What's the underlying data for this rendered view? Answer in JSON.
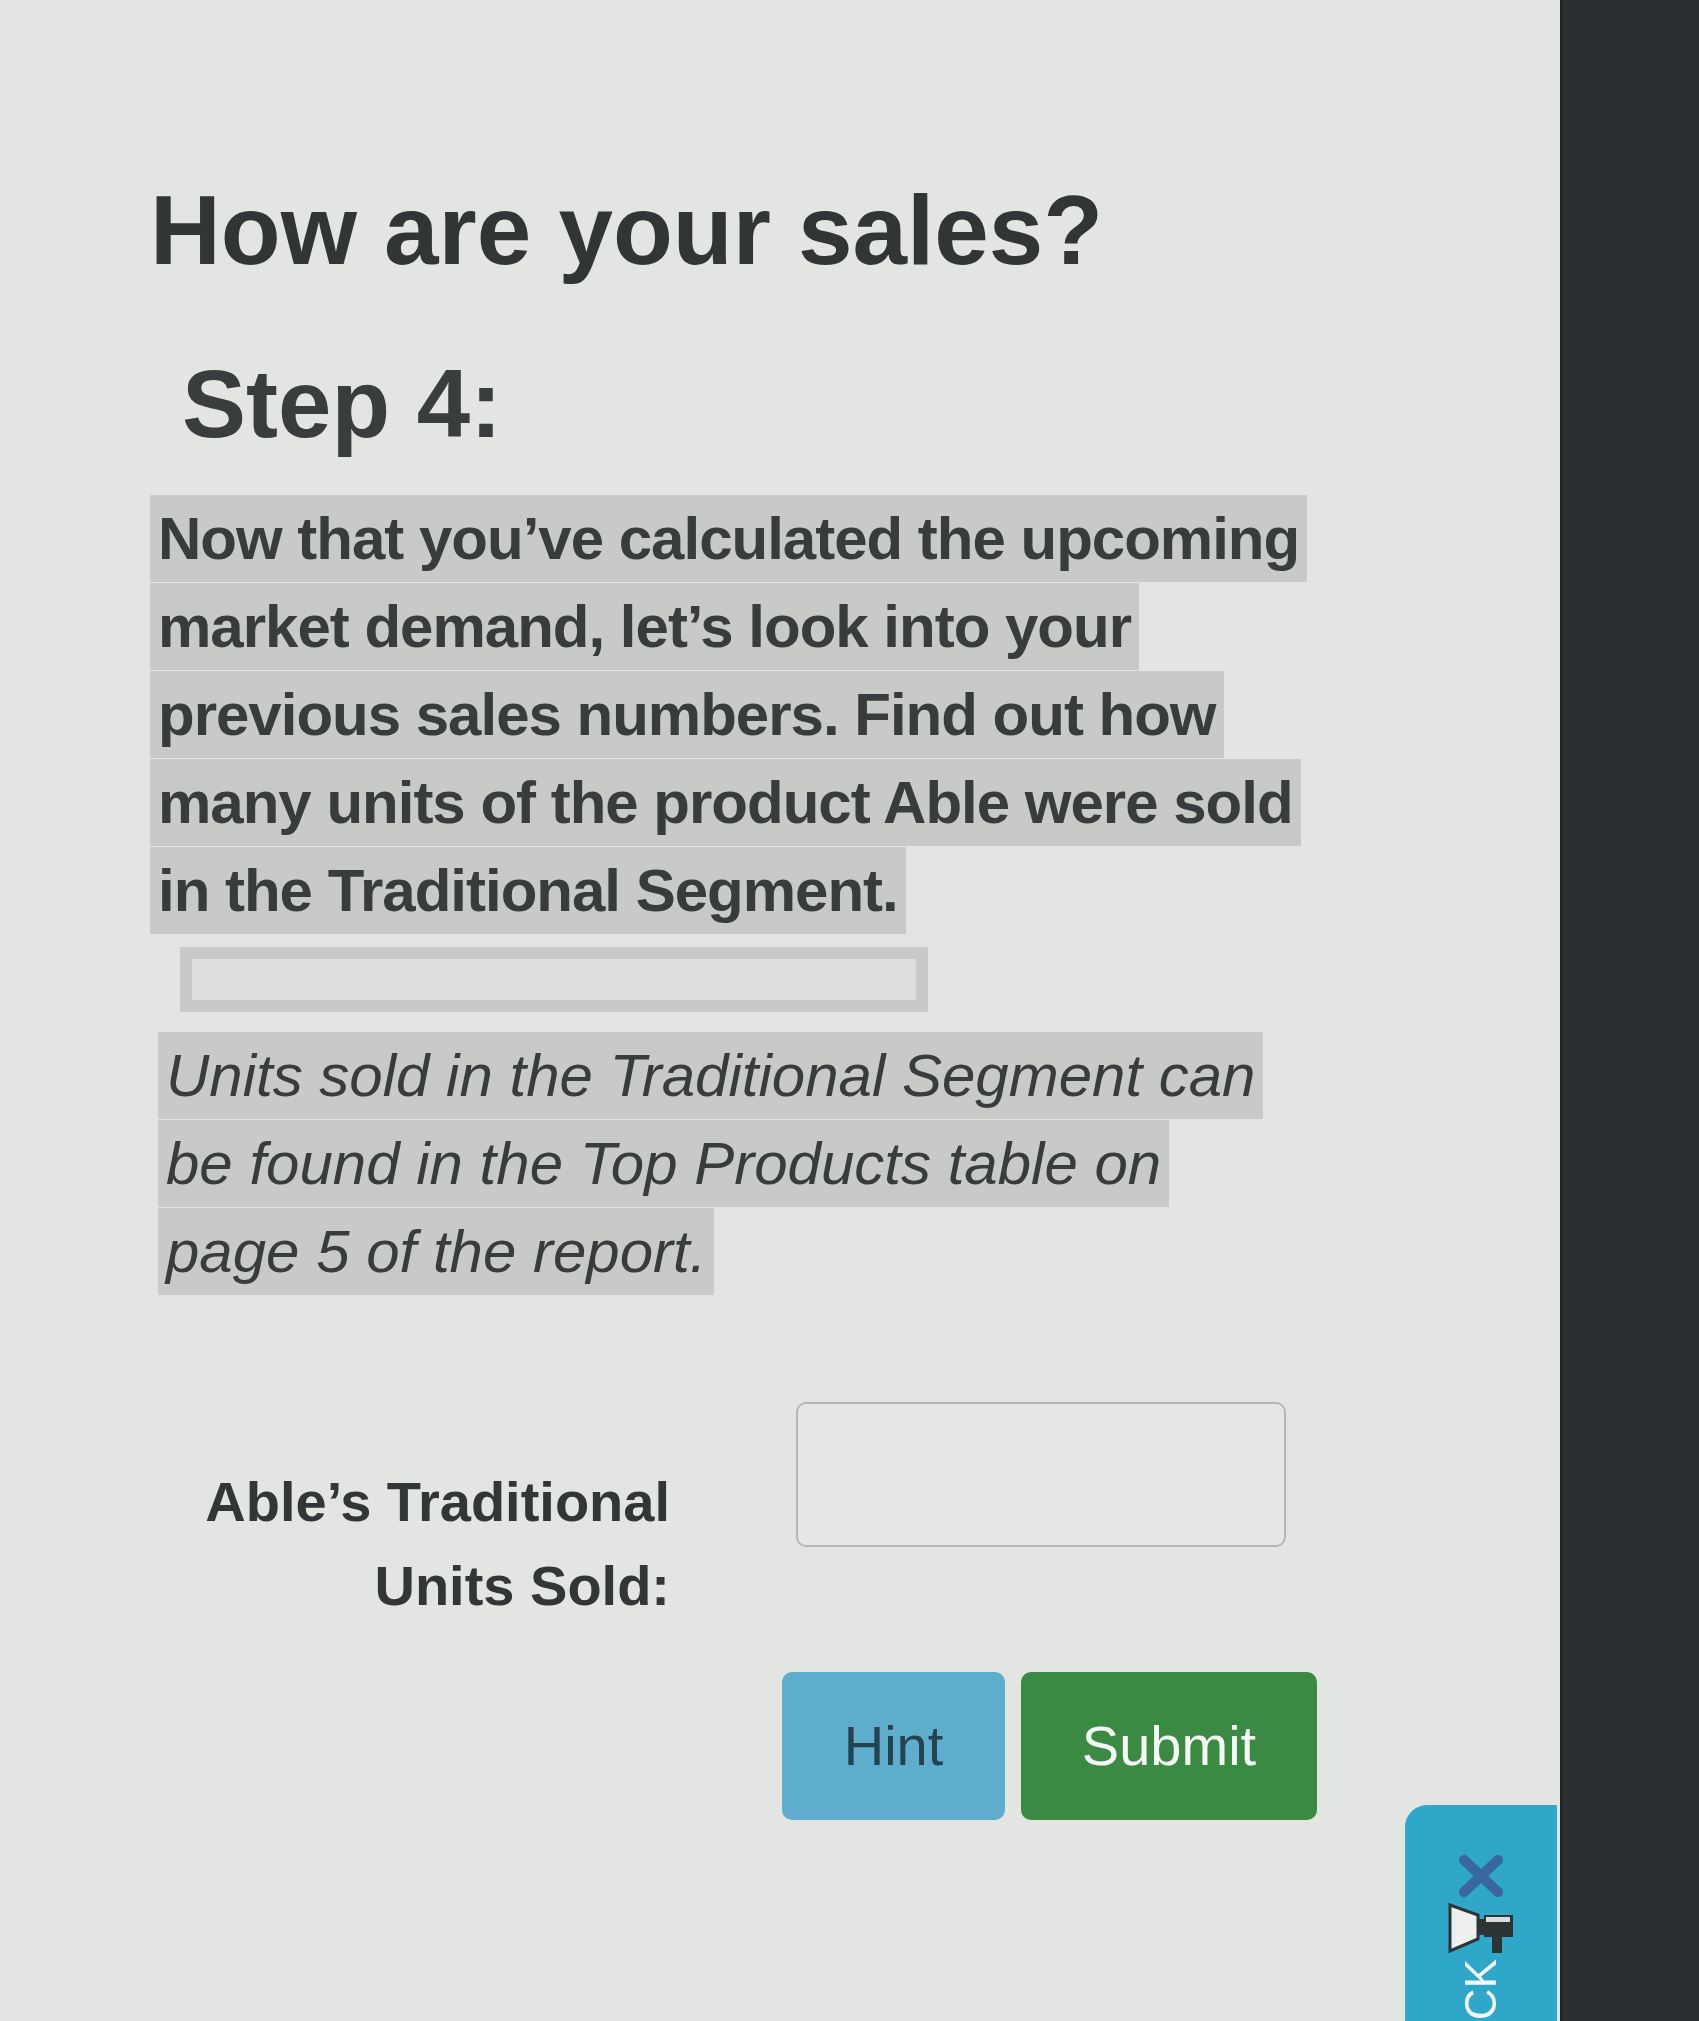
{
  "heading": "How are your sales?",
  "step_title": "Step 4:",
  "paragraphs": [
    {
      "kind": "instruction",
      "text": "Now that you’ve calculated the upcoming market demand, let’s look into your previous sales numbers. Find out how many units of the product Able were sold in the Traditional Segment.",
      "highlighted": true
    },
    {
      "kind": "blank",
      "highlighted": true
    },
    {
      "kind": "note",
      "text": "Units sold in the Traditional Segment can be found in the Top Products table on page 5 of the report.",
      "highlighted": true
    }
  ],
  "answer": {
    "label": "Able’s Traditional Units Sold:"
  },
  "buttons": [
    {
      "kind": "hint",
      "label": "Hint"
    },
    {
      "kind": "submit",
      "label": "Submit"
    }
  ],
  "side_tab": {
    "label": "CK"
  }
}
